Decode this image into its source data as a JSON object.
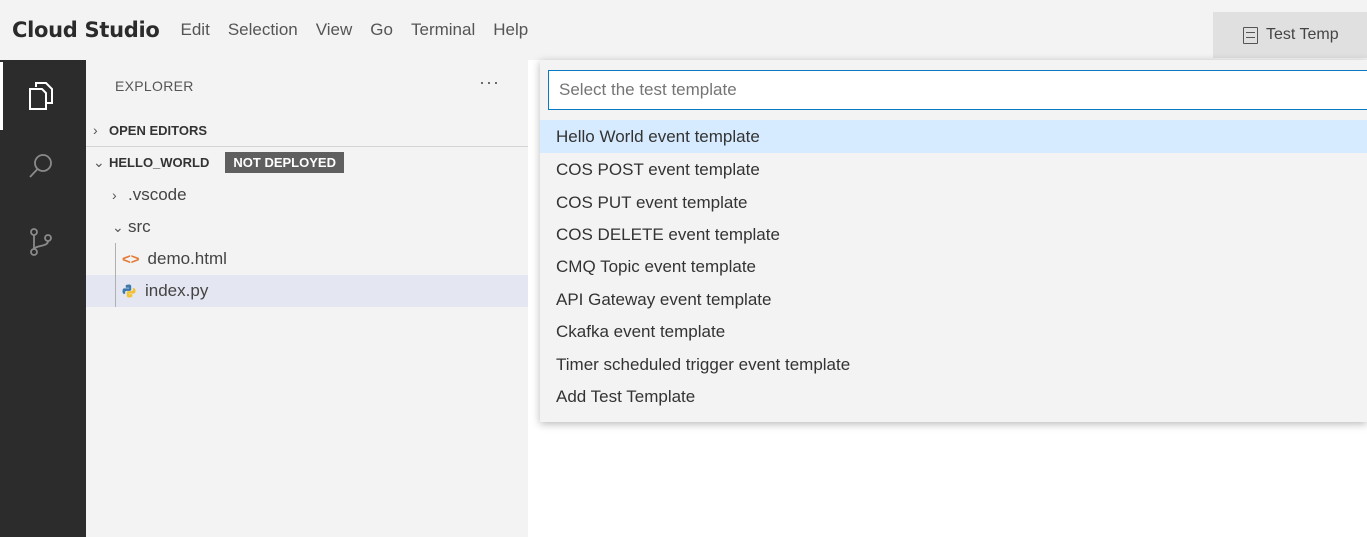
{
  "menubar": {
    "brand": "Cloud Studio",
    "items": [
      "Edit",
      "Selection",
      "View",
      "Go",
      "Terminal",
      "Help"
    ],
    "tab_label": "Test Temp"
  },
  "activity_bar": {
    "items": [
      "explorer-icon",
      "search-icon",
      "source-control-icon"
    ],
    "active": "explorer-icon"
  },
  "sidebar": {
    "title": "EXPLORER",
    "more": "···",
    "open_editors": "OPEN EDITORS",
    "project": "HELLO_WORLD",
    "badge": "NOT DEPLOYED",
    "tree": [
      {
        "label": ".vscode",
        "kind": "folder",
        "expanded": false
      },
      {
        "label": "src",
        "kind": "folder",
        "expanded": true
      },
      {
        "label": "demo.html",
        "kind": "html-file"
      },
      {
        "label": "index.py",
        "kind": "python-file",
        "selected": true
      }
    ]
  },
  "quick_pick": {
    "placeholder": "Select the test template",
    "items": [
      "Hello World event template",
      "COS POST event template",
      "COS PUT event template",
      "COS DELETE event template",
      "CMQ Topic event template",
      "API Gateway event template",
      "Ckafka event template",
      "Timer scheduled trigger event template",
      "Add Test Template"
    ],
    "focused_index": 0
  },
  "colors": {
    "activity_bar": "#2c2c2c",
    "sidebar": "#f3f3f3",
    "focus_border": "#0a7ac3",
    "focused_item": "#d6ebff",
    "badge": "#5f5f5f"
  }
}
